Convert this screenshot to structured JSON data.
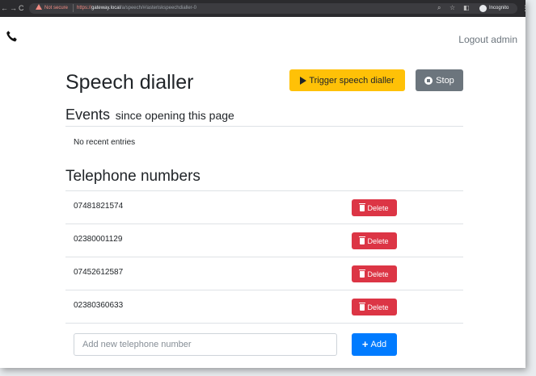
{
  "browser": {
    "security_label": "Not secure",
    "url_scheme": "https://",
    "url_host": "gateway.local",
    "url_path": "/a/speech/#/asteriskspeechdialler-0",
    "profile_label": "Incognito"
  },
  "nav": {
    "logout_label": "Logout admin"
  },
  "page": {
    "title": "Speech dialler",
    "trigger_label": "Trigger speech dialler",
    "stop_label": "Stop"
  },
  "events": {
    "heading": "Events",
    "subheading": "since opening this page",
    "empty_text": "No recent entries"
  },
  "telephone": {
    "heading": "Telephone numbers",
    "delete_label": "Delete",
    "numbers": [
      "07481821574",
      "02380001129",
      "07452612587",
      "02380360633"
    ],
    "add_placeholder": "Add new telephone number",
    "add_label": "Add"
  },
  "colors": {
    "trigger": "#ffc107",
    "stop": "#6c757d",
    "delete": "#dc3545",
    "add": "#007bff",
    "not_secure": "#f28b82"
  },
  "icons": {
    "phone": "phone-icon",
    "play": "play-icon",
    "stop": "stop-circle-icon",
    "trash": "trash-icon",
    "plus": "plus-icon"
  }
}
